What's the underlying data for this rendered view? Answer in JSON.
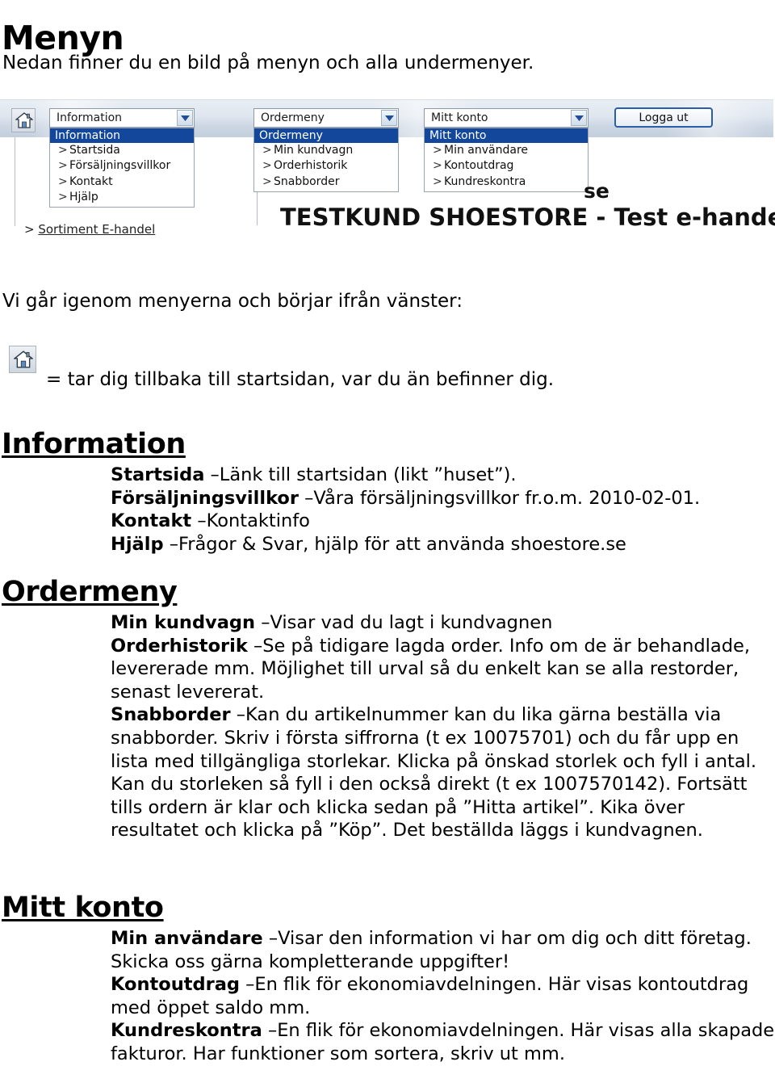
{
  "document": {
    "title": "Menyn",
    "intro": "Nedan finner du en bild på menyn och alla undermenyer.",
    "walkthrough_line": "Vi går igenom menyerna och börjar ifrån vänster:",
    "home_icon_line": "= tar dig tillbaka till startsidan, var du än befinner dig."
  },
  "screenshot": {
    "home_icon_name": "home-icon",
    "logout_button": "Logga ut",
    "store_suffix": "se",
    "store_title": "TESTKUND SHOESTORE  -  Test e-handel",
    "sortiment_link": "Sortiment E-handel",
    "sortiment_prefix": ">",
    "menus": [
      {
        "combo_value": "Information",
        "header": "Information",
        "items": [
          "Startsida",
          "Försäljningsvillkor",
          "Kontakt",
          "Hjälp"
        ]
      },
      {
        "combo_value": "Ordermeny",
        "header": "Ordermeny",
        "items": [
          "Min kundvagn",
          "Orderhistorik",
          "Snabborder"
        ]
      },
      {
        "combo_value": "Mitt konto",
        "header": "Mitt konto",
        "items": [
          "Min användare",
          "Kontoutdrag",
          "Kundreskontra"
        ]
      }
    ],
    "colors": {
      "highlight": "#12479c",
      "highlight_text": "#ffffff",
      "toolbar_top": "#e9eef4",
      "toolbar_bottom": "#c3cedd",
      "button_border": "#2a5ea8"
    }
  },
  "sections": [
    {
      "heading": "Information",
      "entries": [
        {
          "term": "Startsida",
          "desc": " –Länk till startsidan (likt ”huset”)."
        },
        {
          "term": "Försäljningsvillkor",
          "desc": " –Våra försäljningsvillkor fr.o.m. 2010-02-01."
        },
        {
          "term": "Kontakt",
          "desc": " –Kontaktinfo"
        },
        {
          "term": "Hjälp",
          "desc": " –Frågor & Svar, hjälp för att använda shoestore.se"
        }
      ]
    },
    {
      "heading": "Ordermeny",
      "entries": [
        {
          "term": "Min kundvagn",
          "desc": " –Visar vad du lagt i kundvagnen"
        },
        {
          "term": "Orderhistorik",
          "desc": " –Se på tidigare lagda order. Info om de är behandlade, levererade mm. Möjlighet till urval så du enkelt kan se alla restorder, senast levererat."
        },
        {
          "term": "Snabborder",
          "desc": " –Kan du artikelnummer kan du lika gärna beställa via snabborder. Skriv i första siffrorna (t ex 10075701) och du får upp en lista med tillgängliga storlekar. Klicka på önskad storlek och fyll i antal. Kan du storleken så fyll i den också direkt (t ex 1007570142). Fortsätt tills ordern är klar och klicka sedan på ”Hitta artikel”. Kika över resultatet och klicka på ”Köp”. Det beställda läggs i kundvagnen."
        }
      ]
    },
    {
      "heading": "Mitt konto",
      "entries": [
        {
          "term": "Min användare",
          "desc": " –Visar den information vi har om dig och ditt företag. Skicka oss gärna kompletterande uppgifter!"
        },
        {
          "term": "Kontoutdrag",
          "desc": " –En flik för ekonomiavdelningen. Här visas kontoutdrag med öppet saldo mm."
        },
        {
          "term": "Kundreskontra",
          "desc": " –En flik för ekonomiavdelningen. Här visas alla skapade fakturor. Har funktioner som sortera, skriv ut mm."
        }
      ]
    }
  ]
}
